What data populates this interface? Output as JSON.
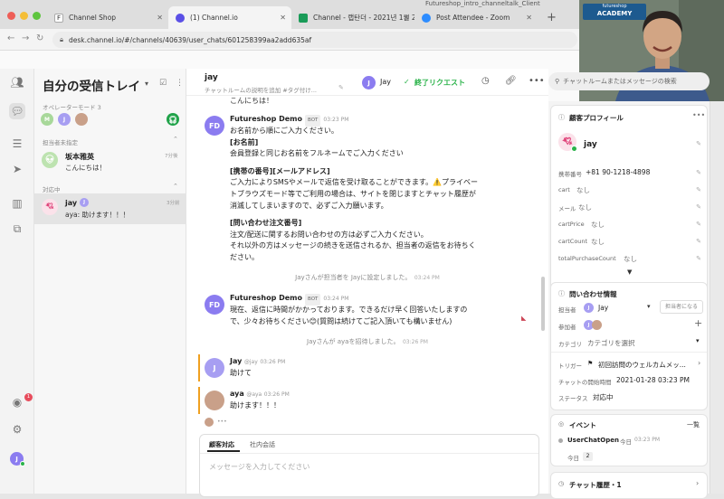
{
  "browser": {
    "window_title": "Futureshop_intro_channeltalk_Client",
    "tabs": [
      {
        "label": "Channel Shop"
      },
      {
        "label": "(1) Channel.io"
      },
      {
        "label": "Channel - 랩탄더 - 2021년 1월 2"
      },
      {
        "label": "Post Attendee - Zoom"
      }
    ],
    "new_tab": "+",
    "url": "desk.channel.io/#/channels/40639/user_chats/601258399aa2add635af"
  },
  "webcam": {
    "banner": "ACADEMY",
    "banner_small": "futureshop"
  },
  "rail": {
    "badge": "1"
  },
  "inbox": {
    "title": "自分の受信トレイ",
    "operator_mode": "オペレーターモード 3",
    "sections": {
      "unassigned": "担当者未指定",
      "open": "対応中"
    },
    "chats": [
      {
        "name": "坂本雅英",
        "preview": "こんにちは！",
        "time": "7分後"
      },
      {
        "name": "jay",
        "preview": "aya: 助けます！！！",
        "time": "3分前"
      }
    ]
  },
  "chat": {
    "header": {
      "name": "jay",
      "description": "チャットルームの説明を追加 #タグ付け...",
      "assignee": "Jay",
      "complete": "終了リクエスト"
    },
    "top_cut": "こんにちは！",
    "messages": [
      {
        "sender": "Futureshop Demo",
        "badge": "BOT",
        "time": "03:23 PM",
        "avatar": "FD",
        "lines": [
          "お名前から順にご入力ください。",
          "[お名前]",
          "会員登録と同じお名前をフルネームでご入力ください",
          "",
          "[携帯の番号][メールアドレス]",
          "ご入力によりSMSやメールで返信を受け取ることができます。⚠️プライベー",
          "トブラウズモード等でご利用の場合は、サイトを閉じますとチャット履歴が",
          "消滅してしまいますので、必ずご入力願います。",
          "",
          "[問い合わせ注文番号]",
          "注文/配送に関するお問い合わせの方は必ずご入力ください。",
          "それ以外の方はメッセージの続きを送信されるか、担当者の返信をお待ちく",
          "ださい。"
        ]
      },
      {
        "sender": "Futureshop Demo",
        "badge": "BOT",
        "time": "03:24 PM",
        "avatar": "FD",
        "lines": [
          "現在、返信に時間がかかっております。できるだけ早く回答いたしますの",
          "で、少々お待ちください😊(質問は続けてご記入頂いても構いません)"
        ]
      },
      {
        "sender": "Jay",
        "handle": "@jay",
        "time": "03:26 PM",
        "avatar": "J",
        "lines": [
          "助けて"
        ]
      },
      {
        "sender": "aya",
        "handle": "@aya",
        "time": "03:26 PM",
        "avatar": "",
        "lines": [
          "助けます！！！"
        ]
      }
    ],
    "system": [
      {
        "text": "Jayさんが担当者を Jayに設定しました。",
        "time": "03:24 PM"
      },
      {
        "text": "Jayさんが ayaを招待しました。",
        "time": "03:26 PM"
      }
    ],
    "typing": "•••",
    "composer": {
      "tabs": [
        "顧客対応",
        "社内会話"
      ],
      "placeholder": "メッセージを入力してください"
    }
  },
  "search": {
    "placeholder": "チャットルームまたはメッセージの検索"
  },
  "profile": {
    "title": "顧客プロフィール",
    "name": "jay",
    "fields": [
      {
        "label": "携帯番号",
        "value": "+81 90-1218-4898"
      },
      {
        "label": "cart",
        "value": "なし"
      },
      {
        "label": "メール",
        "value": "なし"
      },
      {
        "label": "cartPrice",
        "value": "なし"
      },
      {
        "label": "cartCount",
        "value": "なし"
      },
      {
        "label": "totalPurchaseCount",
        "value": "なし"
      }
    ],
    "inquiry": {
      "title": "問い合わせ情報",
      "assignee_label": "担当者",
      "assignee": "Jay",
      "assign_me": "担当者になる",
      "participants_label": "参加者",
      "category_label": "カテゴリ",
      "category": "カテゴリを選択",
      "trigger_label": "トリガー",
      "trigger": "初回訪問のウェルカムメッ...",
      "start_label": "チャットの開始時間",
      "start": "2021-01-28 03:23 PM",
      "status_label": "ステータス",
      "status": "対応中"
    },
    "events": {
      "title": "イベント",
      "list_label": "一覧",
      "event": "UserChatOpen",
      "event_when": "今日",
      "event_time": "03:23 PM",
      "today_label": "今日",
      "today_count": "2"
    },
    "history": {
      "title": "チャット履歴・1"
    }
  },
  "colors": {
    "accent": "#7b73e8",
    "green": "#2bb34a",
    "orange": "#f0a020"
  }
}
